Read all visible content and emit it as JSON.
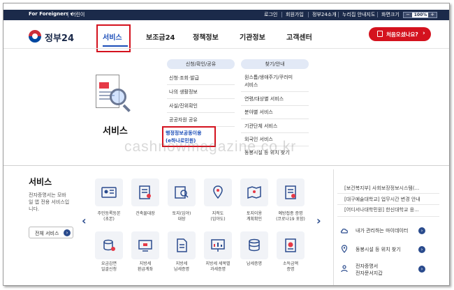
{
  "topbar": {
    "foreigners": "For Foreigners",
    "easy": "어린이",
    "login": "로그인",
    "signup": "회원가입",
    "gov24_intro": "정부24소개",
    "site_guide": "누리집 안내지도",
    "zoom_label": "화면크기",
    "zoom_minus": "−",
    "zoom_value": "100%",
    "zoom_plus": "+"
  },
  "header": {
    "logo_text": "정부24",
    "nav": [
      "서비스",
      "보조금24",
      "정책정보",
      "기관정보",
      "고객센터"
    ],
    "active_index": 0,
    "cta_label": "처음오셨나요?",
    "cta_chevron": "›"
  },
  "mega": {
    "section_title": "서비스",
    "col1_head": "신청/확인/공유",
    "col1_items": [
      "신청·조회·발급",
      "나의 생활정보",
      "사실/진위확인",
      "공공자원 공유",
      "행정정보공동이용",
      "(e하나로민원)"
    ],
    "col2_head": "찾기/안내",
    "col2_items": [
      "원스톱/생애주기/꾸러미",
      "서비스",
      "연령/대상별 서비스",
      "분야별 서비스",
      "기관단체 서비스",
      "외국인 서비스",
      "동봉시설 등 위치 찾기"
    ]
  },
  "watermark": "cashnowmagazine.co.kr",
  "bottom": {
    "title": "서비스",
    "desc": "전자증명서는 모바일 앱 전용 서비스입니다.",
    "all_button": "전체 서비스",
    "circle_arrow": "›",
    "prev_arrow": "‹",
    "next_arrow": "›",
    "tiles_row1": [
      "주민등록등본\n(초본)",
      "건축물대장",
      "토지(임야)\n대장",
      "지적도\n(임야도)",
      "토지이용\n계획확인",
      "예방접종 증명\n(코로나19 포함)"
    ],
    "tiles_row2": [
      "요금감면\n일괄신청",
      "지방세\n환급계좌",
      "지방세\n납세증명",
      "지방세 세목별\n과세증명",
      "납세증명",
      "소득금액\n증명"
    ],
    "news": [
      "[보건복지부] 사회보장정보시스템(...",
      "[대구예술대학교] 업무시간 변경 안내",
      "[어디서나대학민원] 한신대학교 응..."
    ],
    "quick": [
      "내가 관리하는 마이데이터",
      "동봉시설 등 위치 찾기",
      "전자증명서\n전자문서지갑"
    ]
  },
  "colors": {
    "topbar_bg": "#1b2a4a",
    "accent_blue": "#1a4db8",
    "highlight_red": "#d4121e",
    "navy_icon": "#2a4b8d"
  }
}
